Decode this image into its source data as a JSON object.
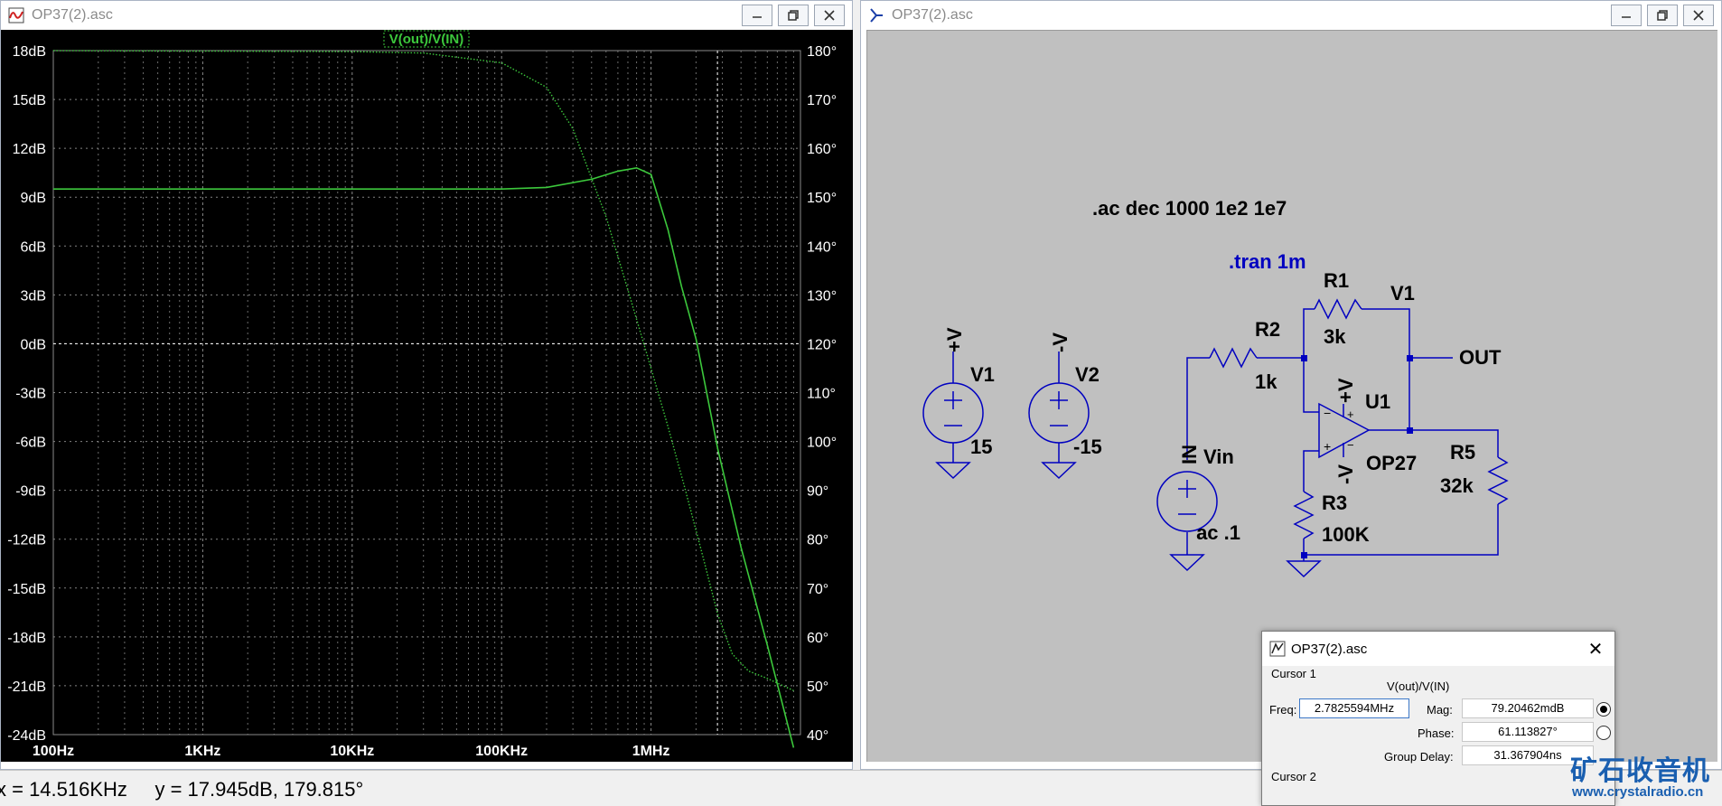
{
  "plot_window": {
    "title": "OP37(2).asc",
    "icon": "waveform-icon",
    "trace_label": "V(out)/V(IN)",
    "colors": {
      "background": "#000000",
      "trace": "#3cc83c",
      "grid": "#9a9a9a",
      "cursor": "#ffffff",
      "label_bg": "#3cc83c"
    }
  },
  "chart_data": {
    "type": "line",
    "title": "V(out)/V(IN)",
    "x_scale": "log",
    "xlim": [
      100,
      10000000
    ],
    "x_ticks": [
      100,
      1000,
      10000,
      100000,
      1000000
    ],
    "x_tick_labels": [
      "100Hz",
      "1KHz",
      "10KHz",
      "100KHz",
      "1MHz"
    ],
    "y_left_lim": [
      -24,
      18
    ],
    "y_left_ticks": [
      18,
      15,
      12,
      9,
      6,
      3,
      0,
      -3,
      -6,
      -9,
      -12,
      -15,
      -18,
      -21,
      -24
    ],
    "y_left_tick_labels": [
      "18dB",
      "15dB",
      "12dB",
      "9dB",
      "6dB",
      "3dB",
      "0dB",
      "-3dB",
      "-6dB",
      "-9dB",
      "-12dB",
      "-15dB",
      "-18dB",
      "-21dB",
      "-24dB"
    ],
    "y_right_lim": [
      40,
      180
    ],
    "y_right_ticks": [
      180,
      170,
      160,
      150,
      140,
      130,
      120,
      110,
      100,
      90,
      80,
      70,
      60,
      50,
      40
    ],
    "y_right_tick_labels": [
      "180°",
      "170°",
      "160°",
      "150°",
      "140°",
      "130°",
      "120°",
      "110°",
      "100°",
      "90°",
      "80°",
      "70°",
      "60°",
      "50°",
      "40°"
    ],
    "grid": true,
    "series": [
      {
        "style": "solid",
        "axis": "left",
        "x": [
          100,
          1000,
          10000,
          100000,
          200000,
          400000,
          600000,
          800000,
          1000000,
          1300000,
          1600000,
          2000000,
          2800000,
          4000000,
          6000000,
          9000000
        ],
        "y": [
          9.5,
          9.5,
          9.5,
          9.5,
          9.6,
          10.1,
          10.6,
          10.8,
          10.4,
          7.0,
          3.5,
          0.3,
          -6.5,
          -12.5,
          -18.5,
          -24.8
        ]
      },
      {
        "style": "dotted",
        "axis": "right",
        "x": [
          100,
          10000,
          30000,
          100000,
          200000,
          300000,
          500000,
          700000,
          1000000,
          1300000,
          1700000,
          2200000,
          2800000,
          3500000,
          4500000,
          6000000,
          9000000
        ],
        "y": [
          180,
          179.8,
          179.5,
          177.5,
          172.5,
          164,
          146,
          131,
          115,
          103,
          90,
          77,
          64.5,
          56.5,
          53,
          51.5,
          49
        ]
      }
    ],
    "cursor": {
      "x": 2782559.4,
      "y_left": 0
    }
  },
  "schematic_window": {
    "title": "OP37(2).asc",
    "icon": "schematic-icon",
    "directives": {
      "ac": ".ac dec 1000 1e2 1e7",
      "tran": ".tran 1m"
    },
    "components": {
      "V1_label": "V1",
      "V1_value": "15",
      "V1_net": "+V",
      "V2_label": "V2",
      "V2_value": "-15",
      "V2_net": "-V",
      "Vin_label": "Vin",
      "Vin_value": "ac .1",
      "Vin_net": "IN",
      "R1_label": "R1",
      "R1_value": "3k",
      "R2_label": "R2",
      "R2_value": "1k",
      "R3_label": "R3",
      "R3_value": "100K",
      "R5_label": "R5",
      "R5_value": "32k",
      "U1_label": "U1",
      "U1_model": "OP27",
      "U1_pos_net": "+V",
      "U1_neg_net": "-V",
      "out_label": "OUT",
      "v1_node_label": "V1",
      "opamp_minus": "−",
      "opamp_plus": "+",
      "pin_plus": "+",
      "pin_minus": "−"
    },
    "colors": {
      "background": "#c0c0c0",
      "wire": "#0000c0",
      "directive_ac": "#000000",
      "directive_tran": "#0000c0",
      "label": "#000000"
    }
  },
  "status_bar": {
    "text": "x = 14.516KHz     y = 17.945dB, 179.815°"
  },
  "cursor_dialog": {
    "title": "OP37(2).asc",
    "cursor1_label": "Cursor 1",
    "expr": "V(out)/V(IN)",
    "freq_label": "Freq:",
    "freq_value": "2.7825594MHz",
    "mag_label": "Mag:",
    "mag_value": "79.20462mdB",
    "phase_label": "Phase:",
    "phase_value": "61.113827°",
    "gd_label": "Group Delay:",
    "gd_value": "31.367904ns",
    "cursor2_label": "Cursor 2",
    "selected_radio": "mag"
  },
  "watermark": {
    "main": "矿石收音机",
    "url": "www.crystalradio.cn"
  }
}
